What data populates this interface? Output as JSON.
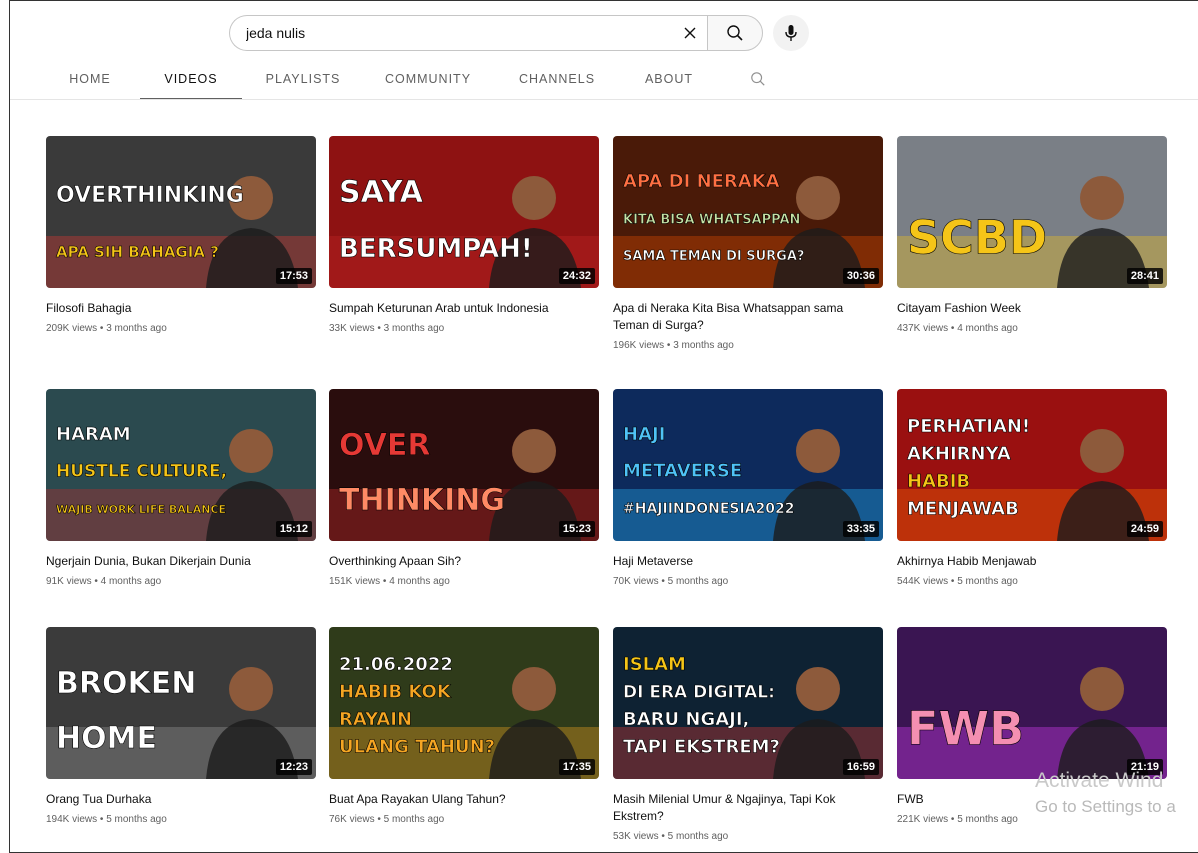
{
  "search": {
    "query": "jeda nulis",
    "placeholder": "Search"
  },
  "tabs": [
    {
      "label": "HOME",
      "active": false
    },
    {
      "label": "VIDEOS",
      "active": true
    },
    {
      "label": "PLAYLISTS",
      "active": false
    },
    {
      "label": "COMMUNITY",
      "active": false
    },
    {
      "label": "CHANNELS",
      "active": false
    },
    {
      "label": "ABOUT",
      "active": false
    }
  ],
  "videos": [
    {
      "title": "Filosofi Bahagia",
      "meta": "209K views • 3 months ago",
      "duration": "17:53",
      "thumb": {
        "bg": "#3a3a3a",
        "accent": "#e53935",
        "lines": [
          "OVERTHINKING",
          "APA SIH BAHAGIA ?"
        ],
        "line_colors": [
          "#ffffff",
          "#f5c518"
        ]
      }
    },
    {
      "title": "Sumpah Keturunan Arab untuk Indonesia",
      "meta": "33K views • 3 months ago",
      "duration": "24:32",
      "thumb": {
        "bg": "#8e1212",
        "accent": "#c62828",
        "lines": [
          "SAYA",
          "BERSUMPAH!"
        ],
        "line_colors": [
          "#ffffff",
          "#ffffff"
        ]
      }
    },
    {
      "title": "Apa di Neraka Kita Bisa Whatsappan sama Teman di Surga?",
      "meta": "196K views • 3 months ago",
      "duration": "30:36",
      "thumb": {
        "bg": "#4a1a08",
        "accent": "#e65100",
        "lines": [
          "APA DI NERAKA",
          "KITA BISA WHATSAPPAN",
          "SAMA TEMAN DI SURGA?"
        ],
        "line_colors": [
          "#ff7043",
          "#c5e1a5",
          "#ffffff"
        ]
      }
    },
    {
      "title": "Citayam Fashion Week",
      "meta": "437K views • 4 months ago",
      "duration": "28:41",
      "thumb": {
        "bg": "#7a7f86",
        "accent": "#f5c518",
        "lines": [
          "SCBD"
        ],
        "line_colors": [
          "#f5c518"
        ]
      }
    },
    {
      "title": "Ngerjain Dunia, Bukan Dikerjain Dunia",
      "meta": "91K views • 4 months ago",
      "duration": "15:12",
      "thumb": {
        "bg": "#2b4a4f",
        "accent": "#c62828",
        "lines": [
          "HARAM",
          "HUSTLE CULTURE,",
          "WAJIB WORK LIFE BALANCE"
        ],
        "line_colors": [
          "#ffffff",
          "#f5c518",
          "#f5c518"
        ]
      }
    },
    {
      "title": "Overthinking Apaan Sih?",
      "meta": "151K views • 4 months ago",
      "duration": "15:23",
      "thumb": {
        "bg": "#2a0d0d",
        "accent": "#d32f2f",
        "lines": [
          "OVER",
          "THINKING"
        ],
        "line_colors": [
          "#e53935",
          "#ff8a65"
        ]
      }
    },
    {
      "title": "Haji Metaverse",
      "meta": "70K views • 5 months ago",
      "duration": "33:35",
      "thumb": {
        "bg": "#0d2a5c",
        "accent": "#29b6f6",
        "lines": [
          "HAJI",
          "METAVERSE",
          "#HAJIINDONESIA2022"
        ],
        "line_colors": [
          "#4fc3f7",
          "#4fc3f7",
          "#ffffff"
        ]
      }
    },
    {
      "title": "Akhirnya Habib Menjawab",
      "meta": "544K views • 5 months ago",
      "duration": "24:59",
      "thumb": {
        "bg": "#9a1010",
        "accent": "#ff6f00",
        "lines": [
          "PERHATIAN!",
          "AKHIRNYA",
          "HABIB",
          "MENJAWAB"
        ],
        "line_colors": [
          "#ffffff",
          "#ffffff",
          "#f5c518",
          "#ffffff"
        ]
      }
    },
    {
      "title": "Orang Tua Durhaka",
      "meta": "194K views • 5 months ago",
      "duration": "12:23",
      "thumb": {
        "bg": "#3b3b3b",
        "accent": "#9e9e9e",
        "lines": [
          "BROKEN",
          "HOME"
        ],
        "line_colors": [
          "#ffffff",
          "#ffffff"
        ]
      }
    },
    {
      "title": "Buat Apa Rayakan Ulang Tahun?",
      "meta": "76K views • 5 months ago",
      "duration": "17:35",
      "thumb": {
        "bg": "#2f3b1a",
        "accent": "#f5a623",
        "lines": [
          "21.06.2022",
          "HABIB KOK",
          "RAYAIN",
          "ULANG TAHUN?"
        ],
        "line_colors": [
          "#ffffff",
          "#f5a623",
          "#f5a623",
          "#f5a623"
        ]
      }
    },
    {
      "title": "Masih Milenial Umur & Ngajinya, Tapi Kok Ekstrem?",
      "meta": "53K views • 5 months ago",
      "duration": "16:59",
      "thumb": {
        "bg": "#0e2233",
        "accent": "#e53935",
        "lines": [
          "ISLAM",
          "DI ERA DIGITAL:",
          "BARU NGAJI,",
          "TAPI EKSTREM?"
        ],
        "line_colors": [
          "#f5c518",
          "#ffffff",
          "#ffffff",
          "#ffffff"
        ]
      }
    },
    {
      "title": "FWB",
      "meta": "221K views • 5 months ago",
      "duration": "21:19",
      "thumb": {
        "bg": "#3a1552",
        "accent": "#e040fb",
        "lines": [
          "FWB"
        ],
        "line_colors": [
          "#f48fb1"
        ]
      }
    }
  ],
  "watermark": {
    "line1": "Activate Wind",
    "line2": "Go to Settings to a"
  }
}
